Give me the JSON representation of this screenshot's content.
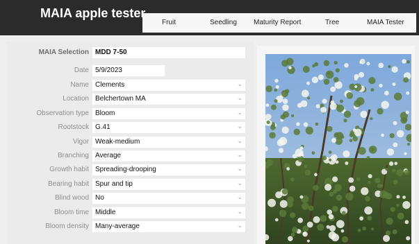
{
  "app": {
    "title": "MAIA apple tester"
  },
  "tabs": [
    {
      "label": "Fruit"
    },
    {
      "label": "Seedling"
    },
    {
      "label": "Maturity Report"
    },
    {
      "label": "Tree"
    },
    {
      "label": "MAIA Tester"
    }
  ],
  "form": {
    "selection": {
      "label": "MAIA Selection",
      "value": "MDD 7-50"
    },
    "date": {
      "label": "Date",
      "value": "5/9/2023"
    },
    "fields": [
      {
        "label": "Name",
        "value": "Clements"
      },
      {
        "label": "Location",
        "value": "Belchertown MA"
      },
      {
        "label": "Observation type",
        "value": "Bloom"
      },
      {
        "label": "Rootstock",
        "value": "G.41"
      },
      {
        "label": "Vigor",
        "value": "Weak-medium"
      },
      {
        "label": "Branching",
        "value": "Average"
      },
      {
        "label": "Growth habit",
        "value": "Spreading-drooping"
      },
      {
        "label": "Bearing habit",
        "value": "Spur and tip"
      },
      {
        "label": "Blind wood",
        "value": "No"
      },
      {
        "label": "Bloom time",
        "value": "Middle"
      },
      {
        "label": "Bloom density",
        "value": "Many-average"
      }
    ]
  },
  "icons": {
    "dropdown": "chevron-down-icon"
  },
  "colors": {
    "header_bg": "#2b2b2b",
    "sky": "#8fb4de",
    "foliage": "#5a7a3a",
    "blossom": "#f4f6f0"
  }
}
